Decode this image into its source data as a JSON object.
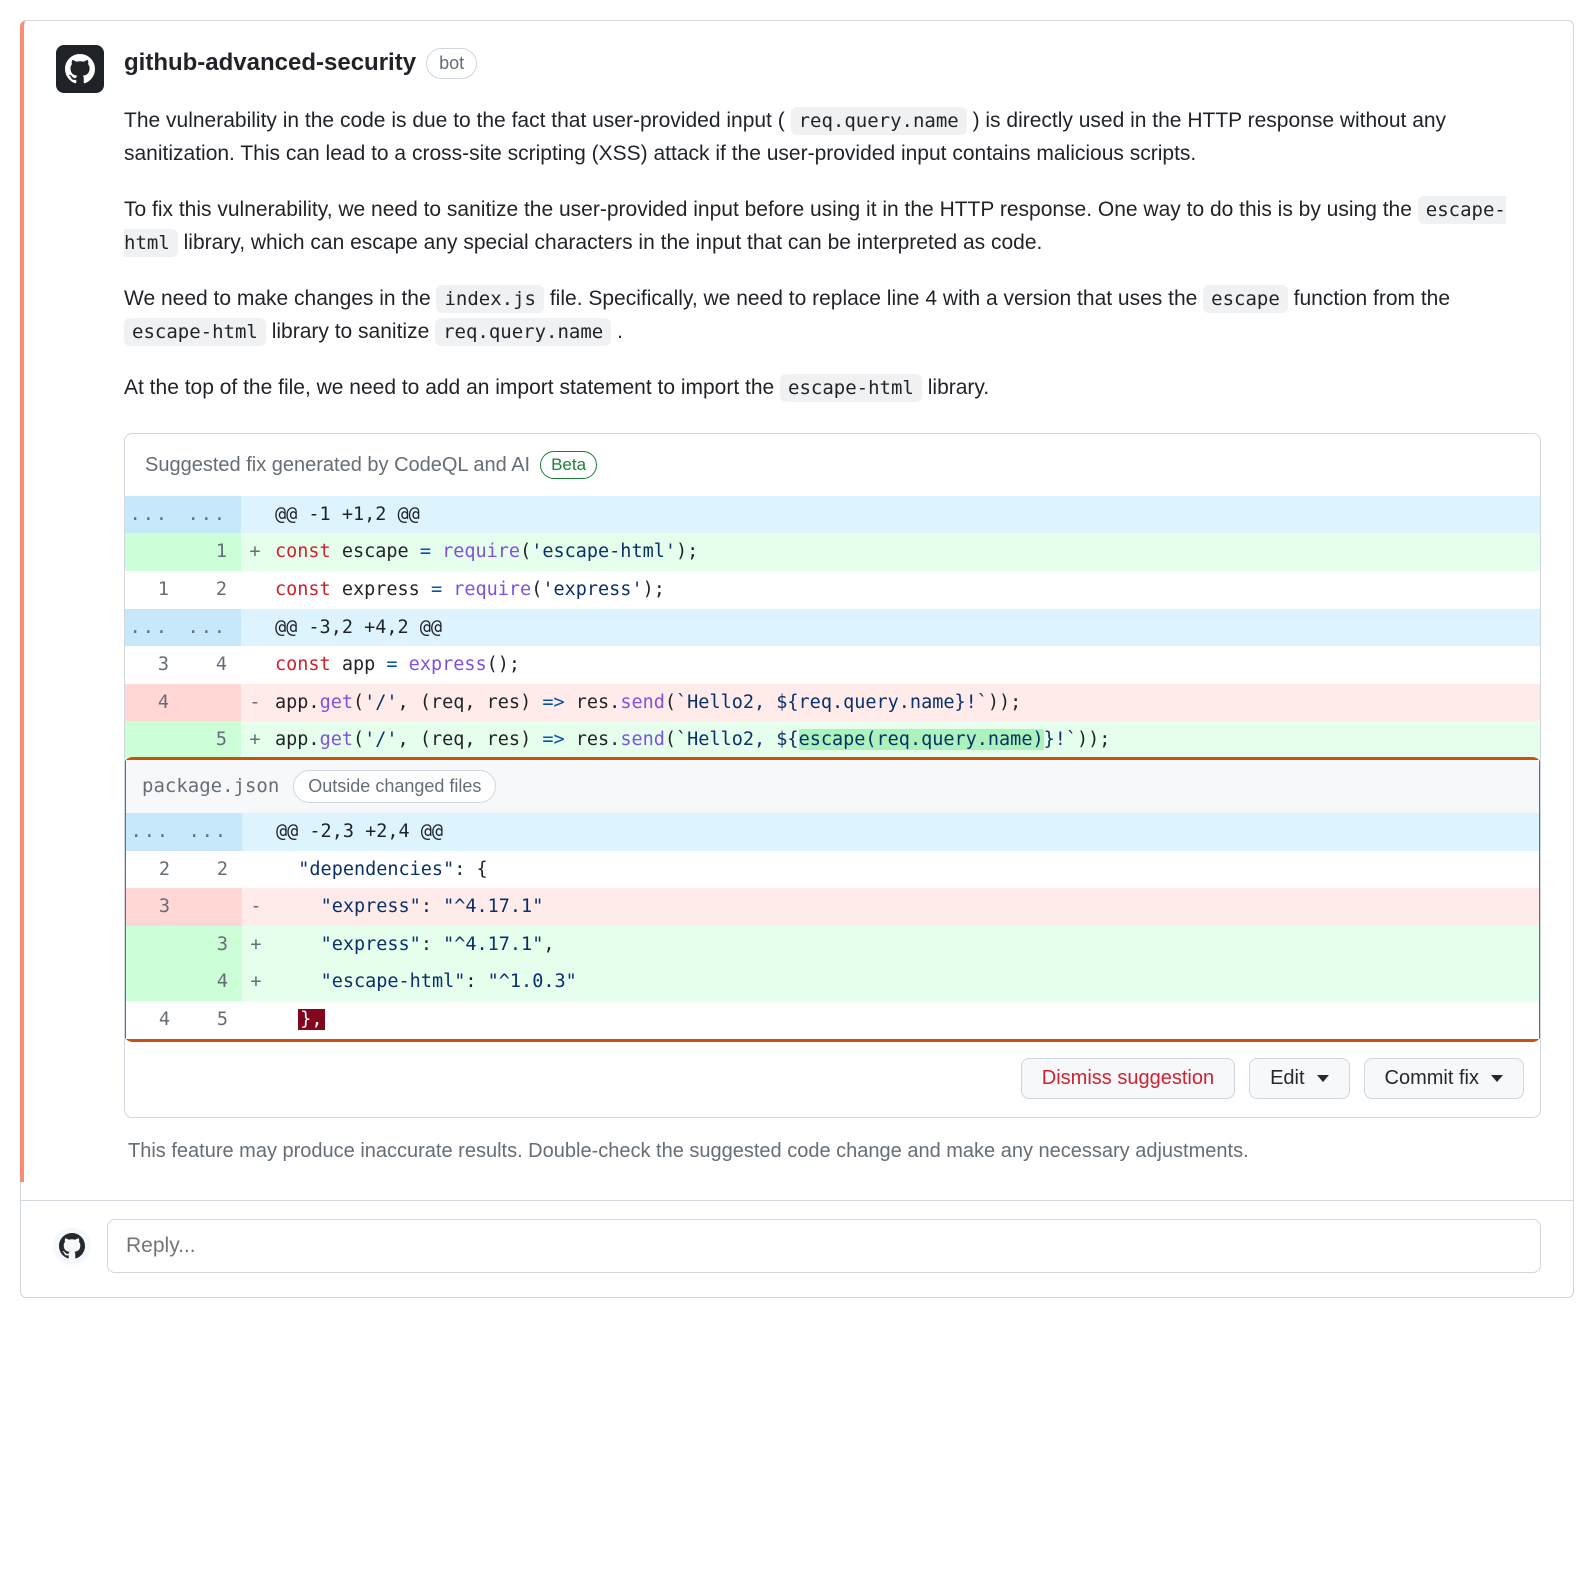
{
  "author": {
    "name": "github-advanced-security",
    "badge": "bot"
  },
  "body": {
    "p1a": "The vulnerability in the code is due to the fact that user-provided input (",
    "p1code": "req.query.name",
    "p1b": ") is directly used in the HTTP response without any sanitization. This can lead to a cross-site scripting (XSS) attack if the user-provided input contains malicious scripts.",
    "p2a": "To fix this vulnerability, we need to sanitize the user-provided input before using it in the HTTP response. One way to do this is by using the ",
    "p2code": "escape-html",
    "p2b": " library, which can escape any special characters in the input that can be interpreted as code.",
    "p3a": "We need to make changes in the ",
    "p3code1": "index.js",
    "p3b": " file. Specifically, we need to replace line 4 with a version that uses the ",
    "p3code2": "escape",
    "p3c": " function from the ",
    "p3code3": "escape-html",
    "p3d": " library to sanitize ",
    "p3code4": "req.query.name",
    "p3e": ".",
    "p4a": "At the top of the file, we need to add an import statement to import the ",
    "p4code": "escape-html",
    "p4b": " library."
  },
  "suggestion": {
    "header": "Suggested fix generated by CodeQL and AI",
    "beta": "Beta",
    "diff1": {
      "hunk1": "@@ -1 +1,2 @@",
      "add1": {
        "kw": "const",
        "name": " escape ",
        "eq": "=",
        "fn": " require",
        "paren": "(",
        "str": "'escape-html'",
        "end": ");"
      },
      "ctx1": {
        "kw": "const",
        "name": " express ",
        "eq": "=",
        "fn": " require",
        "paren": "(",
        "str": "'express'",
        "end": ");"
      },
      "hunk2": "@@ -3,2 +4,2 @@",
      "ctx2": {
        "kw": "const",
        "name": " app ",
        "eq": "=",
        "fn": " express",
        "end": "();"
      },
      "del1": {
        "pre": "app.",
        "fn1": "get",
        "args1": "(",
        "str1": "'/'",
        "mid": ", (req, res) ",
        "arrow": "=>",
        "post": " res.",
        "fn2": "send",
        "args2": "(",
        "tmpl": "`Hello2, ${req.query.name}!`",
        "end": "));"
      },
      "add2": {
        "pre": "app.",
        "fn1": "get",
        "args1": "(",
        "str1": "'/'",
        "mid": ", (req, res) ",
        "arrow": "=>",
        "post": " res.",
        "fn2": "send",
        "args2": "(",
        "tmpl_a": "`Hello2, ${",
        "tmpl_hl": "escape(req.query.name)",
        "tmpl_b": "}!`",
        "end": "));"
      }
    },
    "file2": {
      "name": "package.json",
      "badge": "Outside changed files",
      "hunk": "@@ -2,3 +2,4 @@",
      "ctx1": {
        "key": "\"dependencies\"",
        "rest": ": {"
      },
      "del1": {
        "key": "\"express\"",
        "rest": ": ",
        "val": "\"^4.17.1\""
      },
      "add1": {
        "key": "\"express\"",
        "rest": ": ",
        "val": "\"^4.17.1\"",
        "comma": ","
      },
      "add2": {
        "key": "\"escape-html\"",
        "rest": ": ",
        "val": "\"^1.0.3\""
      },
      "ctx2": "},"
    },
    "nums": {
      "d1_add1_r": "1",
      "d1_ctx1_l": "1",
      "d1_ctx1_r": "2",
      "d1_ctx2_l": "3",
      "d1_ctx2_r": "4",
      "d1_del1_l": "4",
      "d1_add2_r": "5",
      "f2_ctx1_l": "2",
      "f2_ctx1_r": "2",
      "f2_del1_l": "3",
      "f2_add1_r": "3",
      "f2_add2_r": "4",
      "f2_ctx2_l": "4",
      "f2_ctx2_r": "5"
    }
  },
  "actions": {
    "dismiss": "Dismiss suggestion",
    "edit": "Edit",
    "commit": "Commit fix"
  },
  "footnote": "This feature may produce inaccurate results. Double-check the suggested code change and make any necessary adjustments.",
  "reply": {
    "placeholder": "Reply..."
  },
  "ellipsis": "..."
}
